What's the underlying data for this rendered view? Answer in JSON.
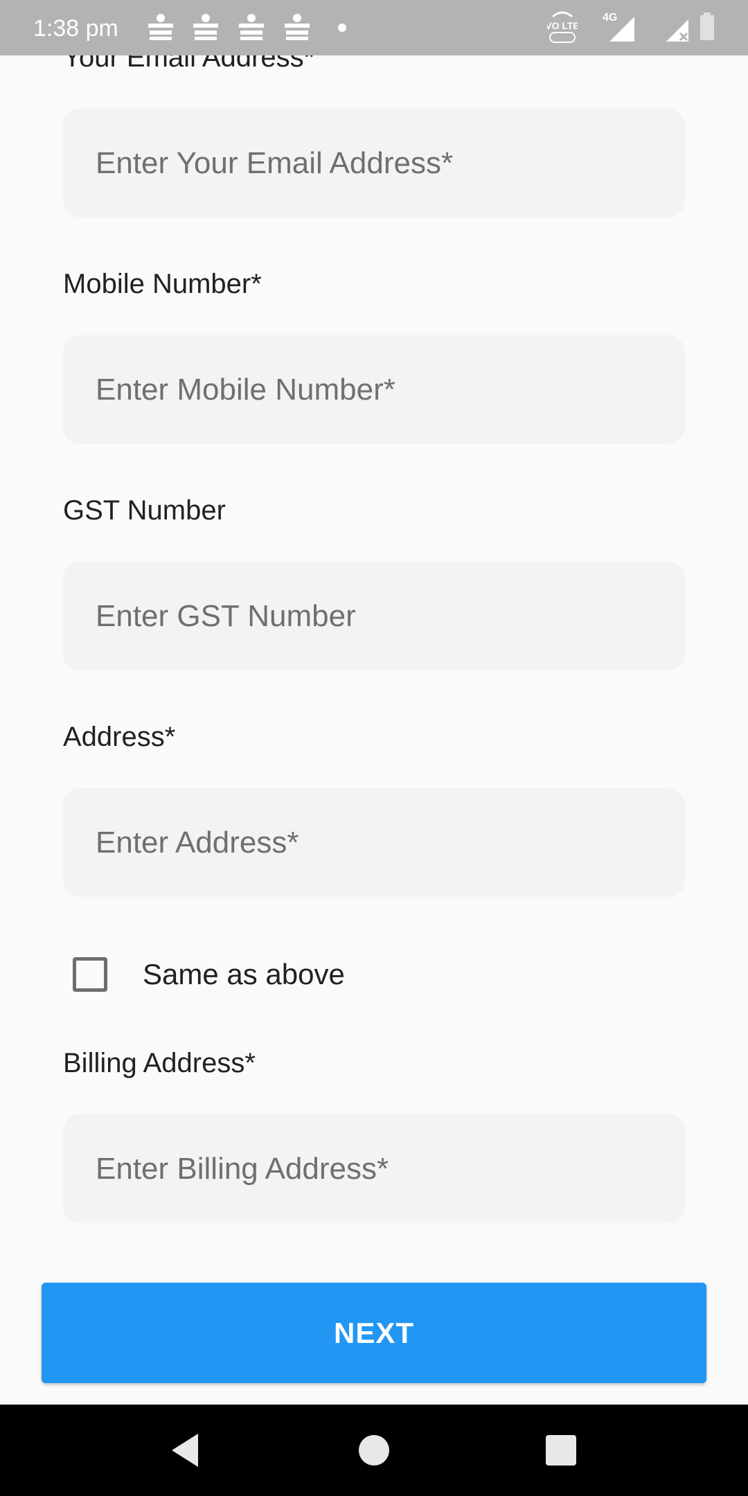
{
  "status_bar": {
    "time": "1:38 pm",
    "network": "4G",
    "volte": "VO LTE",
    "notification_icons": [
      "dainik-bhaskar-icon",
      "dainik-bhaskar-icon",
      "dainik-bhaskar-icon",
      "dainik-bhaskar-icon"
    ]
  },
  "form": {
    "email": {
      "label": "Your Email Address*",
      "placeholder": "Enter Your Email Address*"
    },
    "mobile": {
      "label": "Mobile Number*",
      "placeholder": "Enter Mobile Number*"
    },
    "gst": {
      "label": "GST Number",
      "placeholder": "Enter GST Number"
    },
    "address": {
      "label": "Address*",
      "placeholder": "Enter Address*"
    },
    "same_as_above": {
      "label": "Same as above",
      "checked": false
    },
    "billing": {
      "label": "Billing Address*",
      "placeholder": "Enter Billing Address*"
    }
  },
  "next_button": {
    "label": "NEXT"
  },
  "colors": {
    "accent": "#2196f3",
    "field_bg": "#f3f3f3",
    "status_bar_bg": "#b3b3b3"
  }
}
